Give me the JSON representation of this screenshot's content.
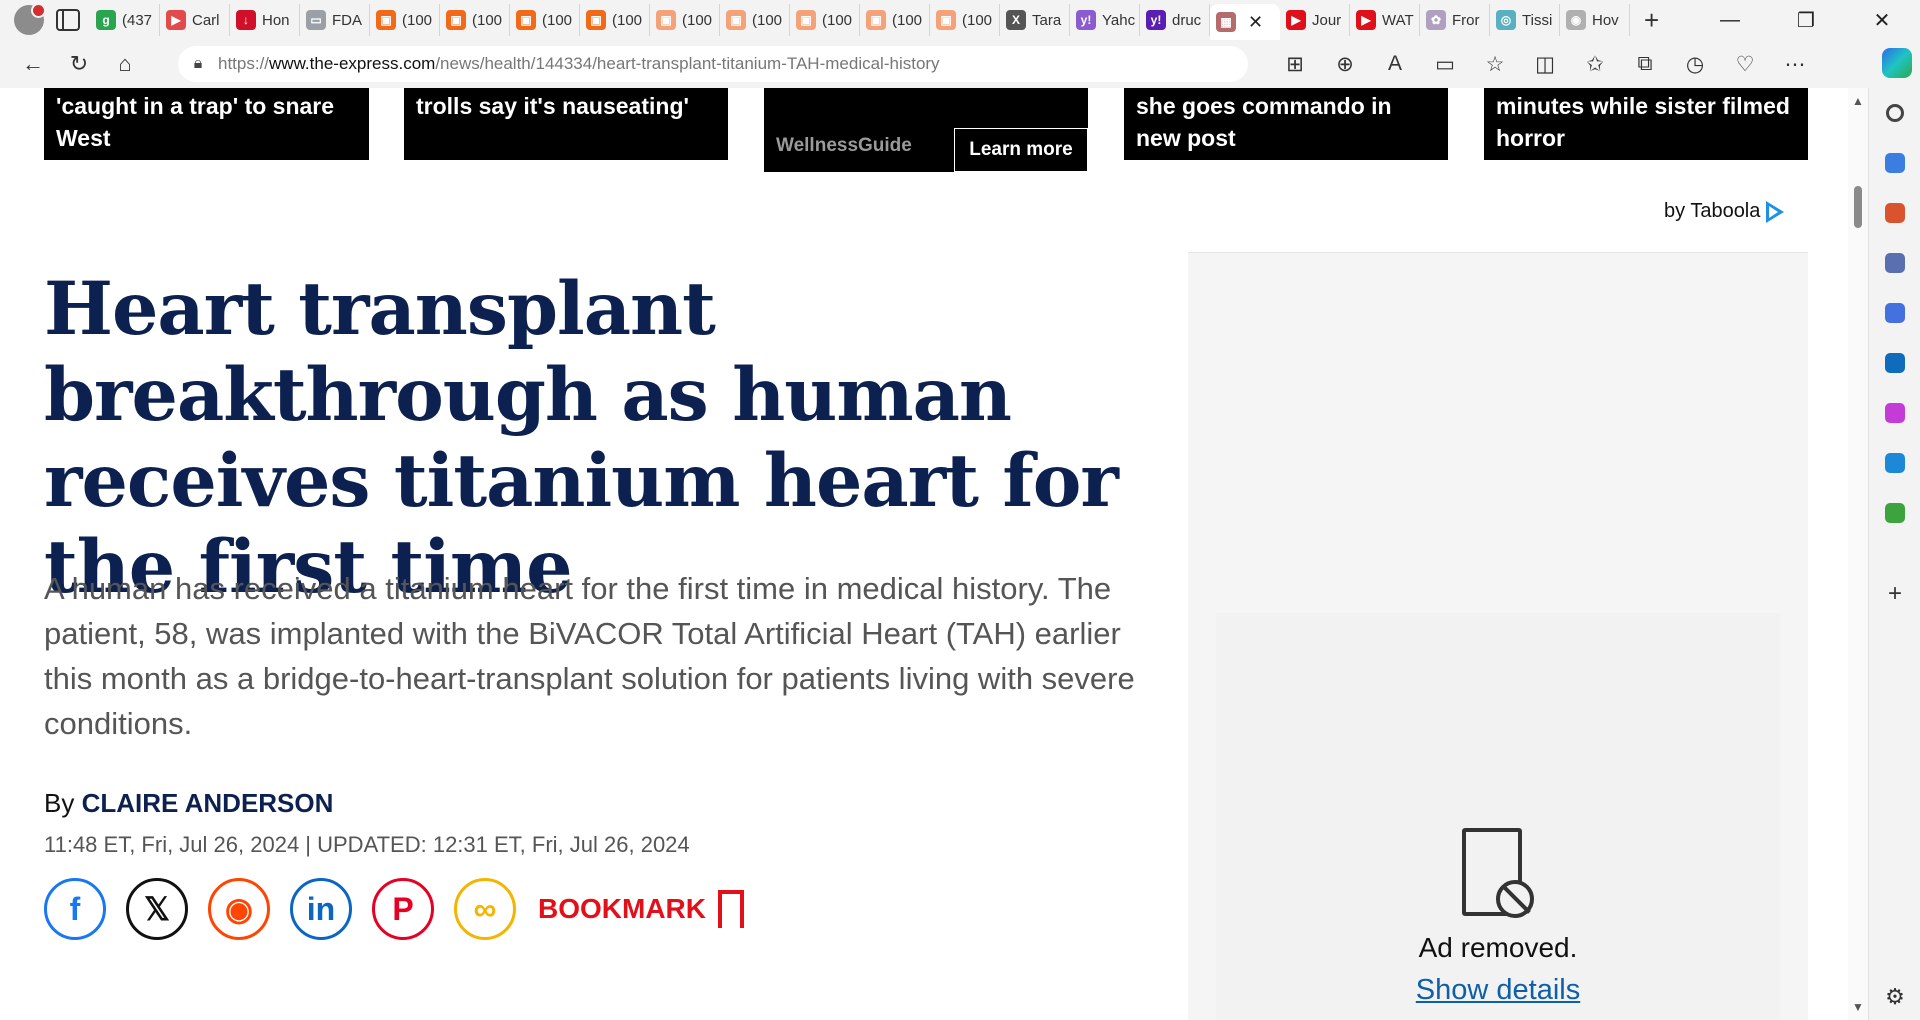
{
  "browser": {
    "tabs": [
      {
        "label": "(437",
        "fav_color": "#2aa44f",
        "glyph": "g"
      },
      {
        "label": "Carl",
        "fav_color": "#e24b4b",
        "glyph": "▶"
      },
      {
        "label": "Hon",
        "fav_color": "#d0102a",
        "glyph": "↓"
      },
      {
        "label": "FDA",
        "fav_color": "#9aa0a6",
        "glyph": "▭"
      },
      {
        "label": "(100",
        "fav_color": "#f06a1a",
        "glyph": "▣"
      },
      {
        "label": "(100",
        "fav_color": "#f06a1a",
        "glyph": "▣"
      },
      {
        "label": "(100",
        "fav_color": "#f06a1a",
        "glyph": "▣"
      },
      {
        "label": "(100",
        "fav_color": "#f06a1a",
        "glyph": "▣"
      },
      {
        "label": "(100",
        "fav_color": "#f4a27a",
        "glyph": "▣"
      },
      {
        "label": "(100",
        "fav_color": "#f4a27a",
        "glyph": "▣"
      },
      {
        "label": "(100",
        "fav_color": "#f4a27a",
        "glyph": "▣"
      },
      {
        "label": "(100",
        "fav_color": "#f4a27a",
        "glyph": "▣"
      },
      {
        "label": "(100",
        "fav_color": "#f4a27a",
        "glyph": "▣"
      },
      {
        "label": "Tara",
        "fav_color": "#555555",
        "glyph": "X"
      },
      {
        "label": "Yahc",
        "fav_color": "#8a5cd0",
        "glyph": "y!"
      },
      {
        "label": "druc",
        "fav_color": "#5a1fb0",
        "glyph": "y!"
      },
      {
        "label": "",
        "fav_color": "#b56b6b",
        "glyph": "▦",
        "active": true
      },
      {
        "label": "Jour",
        "fav_color": "#e0101a",
        "glyph": "▶"
      },
      {
        "label": "WAT",
        "fav_color": "#e0101a",
        "glyph": "▶"
      },
      {
        "label": "Fror",
        "fav_color": "#b0a0c0",
        "glyph": "✿"
      },
      {
        "label": "Tissi",
        "fav_color": "#5ab0c0",
        "glyph": "◎"
      },
      {
        "label": "Hov",
        "fav_color": "#b0b0b0",
        "glyph": "◉"
      }
    ],
    "url_prefix": "https://",
    "url_domain": "www.the-express.com",
    "url_path": "/news/health/144334/heart-transplant-titanium-TAH-medical-history"
  },
  "promos": [
    {
      "text": "'caught in a trap' to snare West"
    },
    {
      "text": "trolls say it's nauseating'"
    },
    {
      "brand": "WellnessGuide",
      "cta": "Learn more"
    },
    {
      "text": "she goes commando in new post"
    },
    {
      "text": "minutes while sister filmed horror"
    }
  ],
  "taboola": {
    "label": "by Taboola"
  },
  "article": {
    "headline": "Heart transplant breakthrough as human receives titanium heart for the first time",
    "standfirst": "A human has received a titanium heart for the first time in medical history. The patient, 58, was implanted with the BiVACOR Total Artificial Heart (TAH) earlier this month as a bridge-to-heart-transplant solution for patients living with severe conditions.",
    "by_prefix": "By",
    "author": "CLAIRE ANDERSON",
    "dateline": "11:48 ET, Fri, Jul 26, 2024 | UPDATED: 12:31 ET, Fri, Jul 26, 2024",
    "bookmark_label": "BOOKMARK"
  },
  "share": [
    {
      "name": "facebook",
      "glyph": "f",
      "color": "#1877f2"
    },
    {
      "name": "x",
      "glyph": "𝕏",
      "color": "#111111"
    },
    {
      "name": "reddit",
      "glyph": "◉",
      "color": "#ff4500"
    },
    {
      "name": "linkedin",
      "glyph": "in",
      "color": "#0a66c2"
    },
    {
      "name": "pinterest",
      "glyph": "P",
      "color": "#e60023"
    },
    {
      "name": "copy-link",
      "glyph": "∞",
      "color": "#f5b400"
    }
  ],
  "ad": {
    "removed_text": "Ad removed.",
    "details_link": "Show details"
  },
  "sidebar_icons": [
    {
      "name": "search-icon",
      "color": "#444444"
    },
    {
      "name": "shopping-tag-icon",
      "color": "#3b7de0"
    },
    {
      "name": "toolbox-icon",
      "color": "#d9542c"
    },
    {
      "name": "games-icon",
      "color": "#5a6fb0"
    },
    {
      "name": "microsoft365-icon",
      "color": "#4470e0"
    },
    {
      "name": "outlook-icon",
      "color": "#0f6cbd"
    },
    {
      "name": "designer-icon",
      "color": "#c43bd8"
    },
    {
      "name": "telegram-icon",
      "color": "#1e88d8"
    },
    {
      "name": "tree-icon",
      "color": "#3da33d"
    }
  ]
}
